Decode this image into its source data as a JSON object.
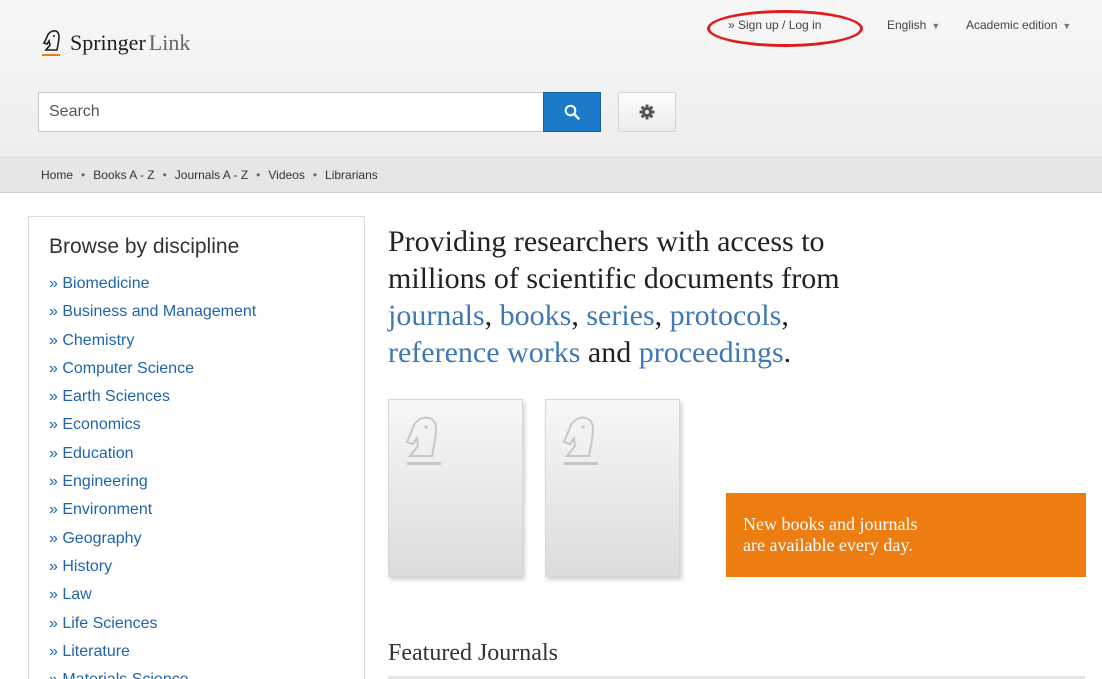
{
  "header": {
    "logo": {
      "brand": "Springer",
      "product": "Link",
      "icon": "springer-horse-logo"
    },
    "search": {
      "placeholder": "Search",
      "value": "",
      "search_icon": "search-icon",
      "settings_icon": "gear-icon"
    },
    "top_links": {
      "signin": "» Sign up / Log in",
      "language": "English",
      "edition": "Academic edition",
      "caret_icon": "▼"
    },
    "colors": {
      "search_button": "#1b7ac9",
      "highlight_ring": "#e01c1c"
    }
  },
  "nav": {
    "separator": "•",
    "items": [
      "Home",
      "Books A - Z",
      "Journals A - Z",
      "Videos",
      "Librarians"
    ]
  },
  "sidebar": {
    "title": "Browse by discipline",
    "items": [
      "» Biomedicine",
      "» Business and Management",
      "» Chemistry",
      "» Computer Science",
      "» Earth Sciences",
      "» Economics",
      "» Education",
      "» Engineering",
      "» Environment",
      "» Geography",
      "» History",
      "» Law",
      "» Life Sciences",
      "» Literature",
      "» Materials Science"
    ]
  },
  "main": {
    "headline": {
      "line1": "Providing researchers with access to",
      "line2": "millions of scientific documents from",
      "links": [
        "journals",
        "books",
        "series",
        "protocols",
        "reference works",
        "proceedings"
      ],
      "connector": "and",
      "comma": ",",
      "period": "."
    },
    "covers": [
      {
        "icon": "springer-horse-placeholder-icon"
      },
      {
        "icon": "springer-horse-placeholder-icon"
      }
    ],
    "promo": {
      "line1": "New books and journals",
      "line2": "are available every day.",
      "color": "#ee7d11"
    },
    "featured_title": "Featured Journals"
  }
}
